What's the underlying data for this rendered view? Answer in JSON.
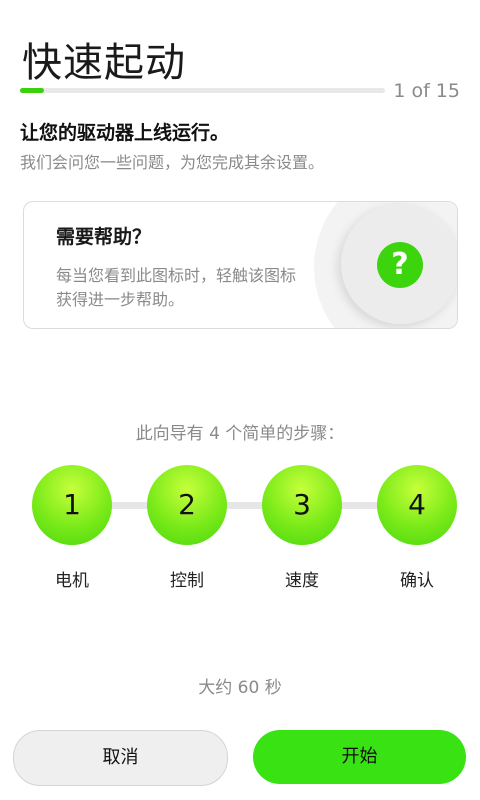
{
  "header": {
    "title": "快速起动",
    "progress_text": "1 of 15",
    "progress_fraction": 0.067,
    "subtitle": "让您的驱动器上线运行。",
    "description": "我们会问您一些问题，为您完成其余设置。"
  },
  "help_card": {
    "title": "需要帮助？",
    "text": "每当您看到此图标时，轻触该图标获得进一步帮助。",
    "icon": "question-mark-icon",
    "icon_glyph": "?"
  },
  "steps": {
    "intro": "此向导有 4 个简单的步骤：",
    "items": [
      {
        "number": "1",
        "label": "电机"
      },
      {
        "number": "2",
        "label": "控制"
      },
      {
        "number": "3",
        "label": "速度"
      },
      {
        "number": "4",
        "label": "确认"
      }
    ]
  },
  "duration": "大约 60 秒",
  "buttons": {
    "cancel": "取消",
    "start": "开始"
  },
  "colors": {
    "accent": "#3ad10a",
    "step_gradient_top": "#c6ff3a",
    "step_gradient_bottom": "#49d70f",
    "cancel_bg": "#efefef"
  }
}
